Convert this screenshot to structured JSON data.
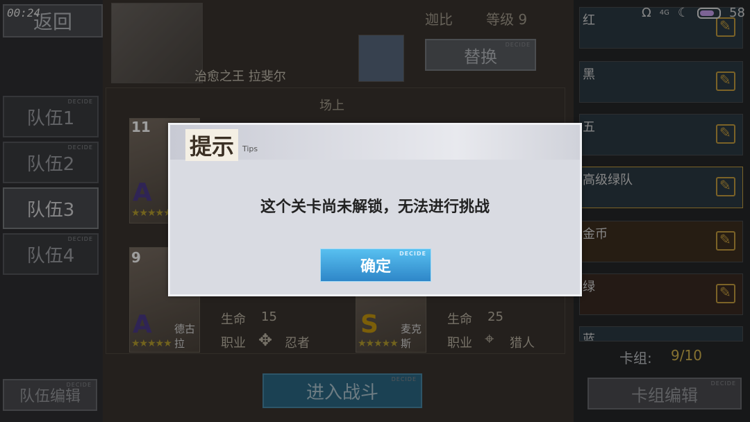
{
  "status": {
    "time": "00:24",
    "battery": "58",
    "network": "4G"
  },
  "nav": {
    "back_label": "返回"
  },
  "teams": [
    "队伍1",
    "队伍2",
    "队伍3",
    "队伍4"
  ],
  "active_team_index": 2,
  "team_edit_label": "队伍编辑",
  "decide_tag": "DECIDE",
  "player": {
    "name": "迦比",
    "level_label": "等级 9"
  },
  "leader": {
    "name": "治愈之王 拉斐尔"
  },
  "swap_label": "替换",
  "field_label": "场上",
  "cards": [
    {
      "level": "11",
      "rank": "A",
      "stars": "★★★★★"
    },
    {
      "level": "9",
      "rank": "A",
      "stars": "★★★★★",
      "name": "德古拉",
      "hp_label": "生命",
      "hp": "15",
      "job_label": "职业",
      "job": "忍者"
    },
    {
      "rank": "S",
      "stars": "★★★★★",
      "name": "麦克斯",
      "hp_label": "生命",
      "hp": "25",
      "job_label": "职业",
      "job": "猎人"
    }
  ],
  "enter_battle_label": "进入战斗",
  "decks": [
    {
      "label": "红"
    },
    {
      "label": "黑"
    },
    {
      "label": "五"
    },
    {
      "label": "高级绿队"
    },
    {
      "label": "金币"
    },
    {
      "label": "绿"
    },
    {
      "label": "蓝"
    }
  ],
  "deck_count": {
    "label": "卡组:",
    "value": "9/10"
  },
  "deck_edit_label": "卡组编辑",
  "dialog": {
    "title": "提示",
    "subtitle": "Tips",
    "message": "这个关卡尚未解锁，无法进行挑战",
    "ok_label": "确定"
  },
  "colors": {
    "accent_blue": "#3a9ad8",
    "gold": "#d8b850"
  }
}
